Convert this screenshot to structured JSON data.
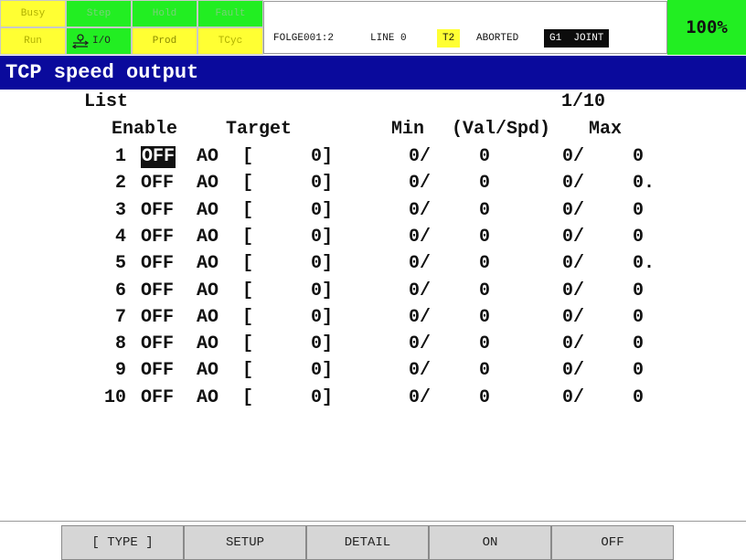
{
  "status_indicators": {
    "busy": "Busy",
    "step": "Step",
    "hold": "Hold",
    "fault": "Fault",
    "run": "Run",
    "io": "I/O",
    "prod": "Prod",
    "tcyc": "TCyc"
  },
  "status_line": {
    "program": "FOLGE001:2",
    "line": "LINE 0",
    "mode": "T2",
    "state": "ABORTED",
    "group": "G1",
    "coord": "JOINT"
  },
  "override": "100%",
  "title": "TCP speed output",
  "list_label": "List",
  "page": "1/10",
  "headers": {
    "enable": "Enable",
    "target": "Target",
    "min": "Min",
    "valspd": "(Val/Spd)",
    "max": "Max"
  },
  "rows": [
    {
      "no": "1",
      "enable": "OFF",
      "type": "AO",
      "bracket": "[",
      "idx": "0]",
      "min_val": "0/",
      "min_spd": "0",
      "max_val": "0/",
      "max_spd": "0"
    },
    {
      "no": "2",
      "enable": "OFF",
      "type": "AO",
      "bracket": "[",
      "idx": "0]",
      "min_val": "0/",
      "min_spd": "0",
      "max_val": "0/",
      "max_spd": "0."
    },
    {
      "no": "3",
      "enable": "OFF",
      "type": "AO",
      "bracket": "[",
      "idx": "0]",
      "min_val": "0/",
      "min_spd": "0",
      "max_val": "0/",
      "max_spd": "0"
    },
    {
      "no": "4",
      "enable": "OFF",
      "type": "AO",
      "bracket": "[",
      "idx": "0]",
      "min_val": "0/",
      "min_spd": "0",
      "max_val": "0/",
      "max_spd": "0"
    },
    {
      "no": "5",
      "enable": "OFF",
      "type": "AO",
      "bracket": "[",
      "idx": "0]",
      "min_val": "0/",
      "min_spd": "0",
      "max_val": "0/",
      "max_spd": "0."
    },
    {
      "no": "6",
      "enable": "OFF",
      "type": "AO",
      "bracket": "[",
      "idx": "0]",
      "min_val": "0/",
      "min_spd": "0",
      "max_val": "0/",
      "max_spd": "0"
    },
    {
      "no": "7",
      "enable": "OFF",
      "type": "AO",
      "bracket": "[",
      "idx": "0]",
      "min_val": "0/",
      "min_spd": "0",
      "max_val": "0/",
      "max_spd": "0"
    },
    {
      "no": "8",
      "enable": "OFF",
      "type": "AO",
      "bracket": "[",
      "idx": "0]",
      "min_val": "0/",
      "min_spd": "0",
      "max_val": "0/",
      "max_spd": "0"
    },
    {
      "no": "9",
      "enable": "OFF",
      "type": "AO",
      "bracket": "[",
      "idx": "0]",
      "min_val": "0/",
      "min_spd": "0",
      "max_val": "0/",
      "max_spd": "0"
    },
    {
      "no": "10",
      "enable": "OFF",
      "type": "AO",
      "bracket": "[",
      "idx": "0]",
      "min_val": "0/",
      "min_spd": "0",
      "max_val": "0/",
      "max_spd": "0"
    }
  ],
  "function_keys": [
    "[ TYPE ]",
    "SETUP",
    "DETAIL",
    "ON",
    "OFF"
  ],
  "colors": {
    "indicator_yellow": "#ffff33",
    "indicator_green": "#22ee22",
    "title_bar": "#0a0a9c",
    "cursor": "#111111"
  }
}
